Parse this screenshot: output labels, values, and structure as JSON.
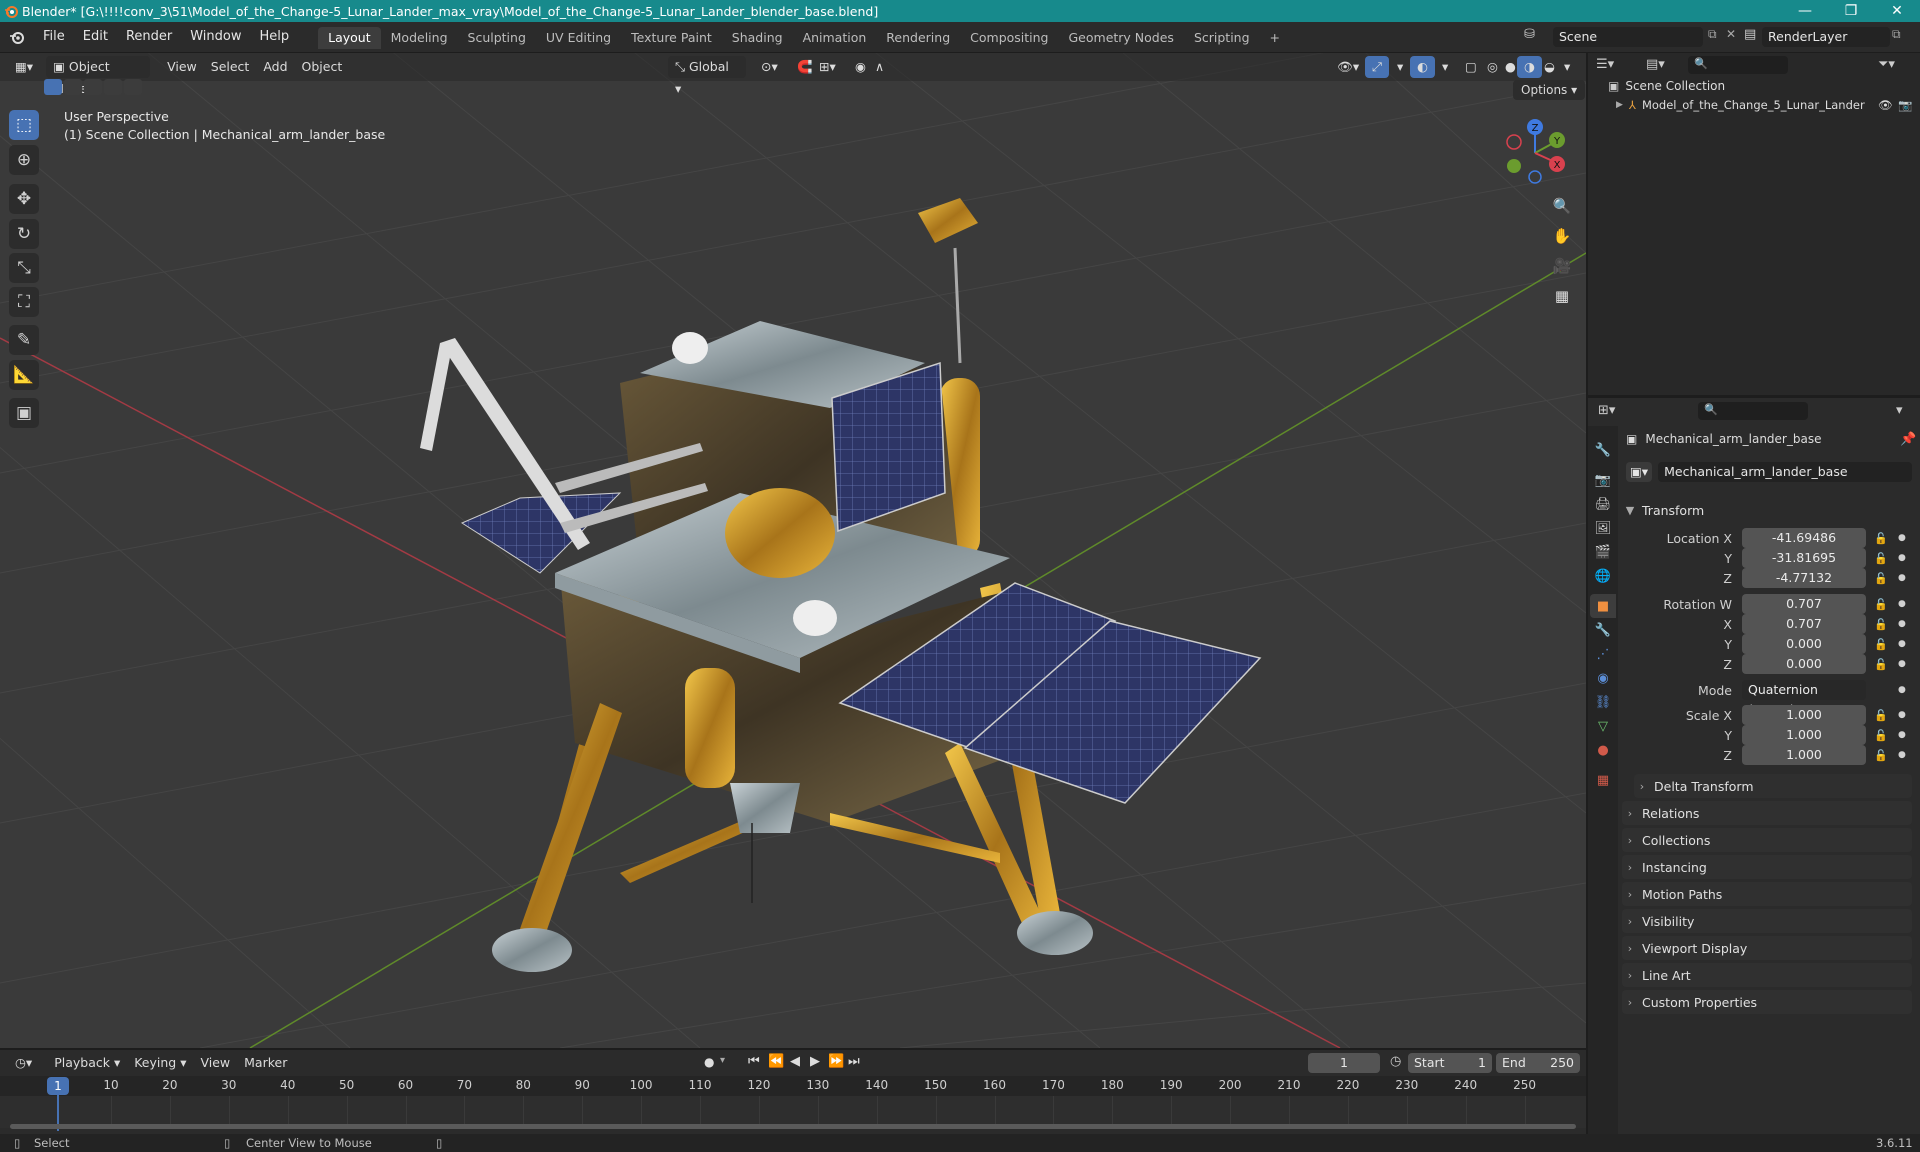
{
  "window": {
    "title": "Blender* [G:\\!!!!conv_3\\51\\Model_of_the_Change-5_Lunar_Lander_max_vray\\Model_of_the_Change-5_Lunar_Lander_blender_base.blend]",
    "minimize": "—",
    "maximize": "❐",
    "close": "✕"
  },
  "menu": {
    "items": [
      "File",
      "Edit",
      "Render",
      "Window",
      "Help"
    ]
  },
  "workspaces": {
    "tabs": [
      "Layout",
      "Modeling",
      "Sculpting",
      "UV Editing",
      "Texture Paint",
      "Shading",
      "Animation",
      "Rendering",
      "Compositing",
      "Geometry Nodes",
      "Scripting"
    ],
    "active": "Layout",
    "add": "+"
  },
  "scene": {
    "name": "Scene",
    "view_layer": "RenderLayer"
  },
  "viewport": {
    "mode": "Object Mode",
    "menus": [
      "View",
      "Select",
      "Add",
      "Object"
    ],
    "orientation": "Global",
    "options": "Options",
    "overlay_title": "User Perspective",
    "overlay_subtitle": "(1) Scene Collection | Mechanical_arm_lander_base",
    "gizmo_axes": {
      "x": "X",
      "y": "Y",
      "z": "Z"
    },
    "colors": {
      "x_axis": "#d9414e",
      "y_axis": "#6b9c2e",
      "z_axis": "#3f7ae0",
      "grid": "#444444",
      "bg": "#3a3a3a"
    }
  },
  "outliner": {
    "root": "Scene Collection",
    "items": [
      {
        "label": "Model_of_the_Change_5_Lunar_Lander"
      }
    ]
  },
  "properties": {
    "object_name": "Mechanical_arm_lander_base",
    "data_name": "Mechanical_arm_lander_base",
    "transform_header": "Transform",
    "location": {
      "label": "Location X",
      "x": "-41.69486",
      "y_label": "Y",
      "y": "-31.81695",
      "z_label": "Z",
      "z": "-4.77132"
    },
    "rotation": {
      "label": "Rotation W",
      "w": "0.707",
      "x_label": "X",
      "x": "0.707",
      "y_label": "Y",
      "y": "0.000",
      "z_label": "Z",
      "z": "0.000"
    },
    "mode": {
      "label": "Mode",
      "value": "Quaternion (WXYZ)"
    },
    "scale": {
      "label": "Scale X",
      "x": "1.000",
      "y_label": "Y",
      "y": "1.000",
      "z_label": "Z",
      "z": "1.000"
    },
    "delta_transform": "Delta Transform",
    "panels": [
      "Relations",
      "Collections",
      "Instancing",
      "Motion Paths",
      "Visibility",
      "Viewport Display",
      "Line Art",
      "Custom Properties"
    ]
  },
  "timeline": {
    "menus": [
      "Playback",
      "Keying",
      "View",
      "Marker"
    ],
    "current_frame": "1",
    "start_label": "Start",
    "start": "1",
    "end_label": "End",
    "end": "250",
    "ruler": [
      "10",
      "20",
      "30",
      "40",
      "50",
      "60",
      "70",
      "80",
      "90",
      "100",
      "110",
      "120",
      "130",
      "140",
      "150",
      "160",
      "170",
      "180",
      "190",
      "200",
      "210",
      "220",
      "230",
      "240",
      "250"
    ],
    "cursor_label": "1"
  },
  "status": {
    "select": "Select",
    "center": "Center View to Mouse",
    "version": "3.6.11"
  }
}
